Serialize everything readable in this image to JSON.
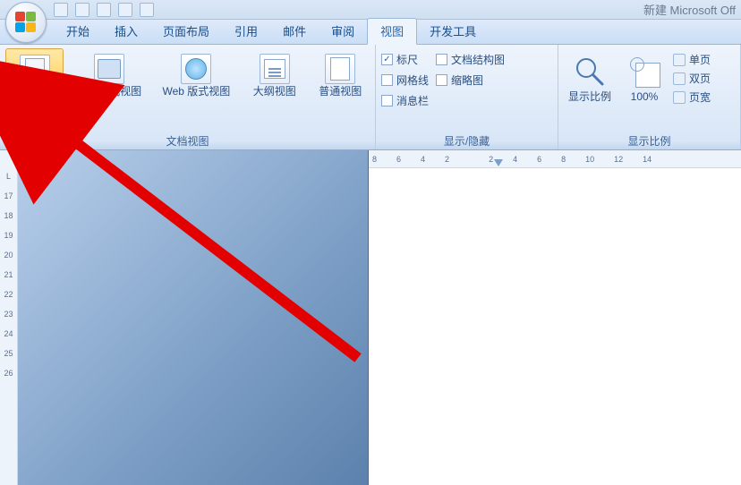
{
  "window": {
    "title": "新建 Microsoft Off"
  },
  "tabs": {
    "start": "开始",
    "insert": "插入",
    "pagelayout": "页面布局",
    "references": "引用",
    "mail": "邮件",
    "review": "审阅",
    "view": "视图",
    "dev": "开发工具"
  },
  "groups": {
    "docviews": {
      "label": "文档视图",
      "pageview": "页面视图",
      "readview": "阅读版式视图",
      "webview": "Web 版式视图",
      "outlineview": "大纲视图",
      "normalview": "普通视图"
    },
    "showhide": {
      "label": "显示/隐藏",
      "ruler": "标尺",
      "gridlines": "网格线",
      "messagebar": "消息栏",
      "docmap": "文档结构图",
      "thumbnails": "缩略图"
    },
    "zoom": {
      "label": "显示比例",
      "zoom": "显示比例",
      "hundred": "100%",
      "onepage": "单页",
      "twopages": "双页",
      "pagewidth": "页宽"
    }
  },
  "ruler": {
    "v": [
      "L",
      "17",
      "18",
      "19",
      "20",
      "21",
      "22",
      "23",
      "24",
      "25",
      "26"
    ],
    "h": [
      "8",
      "6",
      "4",
      "2",
      "",
      "2",
      "4",
      "6",
      "8",
      "10",
      "12",
      "14"
    ]
  }
}
